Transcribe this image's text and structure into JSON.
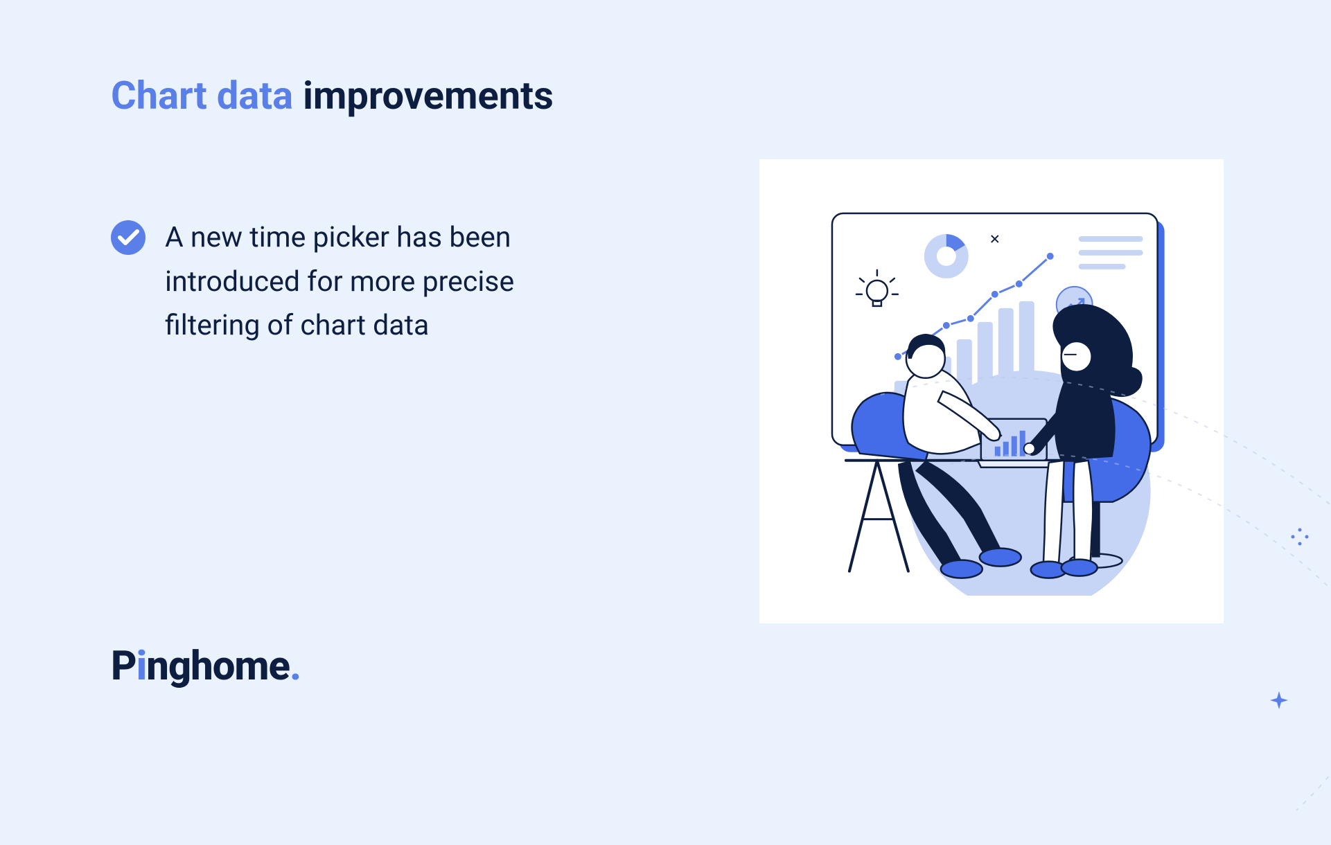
{
  "heading": {
    "highlight": "Chart data",
    "normal": "improvements"
  },
  "bullet": {
    "text": "A new time picker has been introduced for more precise filtering of chart data"
  },
  "logo": {
    "prefix": "P",
    "i_char": "i",
    "suffix": "nghome",
    "period": "."
  },
  "colors": {
    "background": "#EAF2FE",
    "accent": "#5B7FE8",
    "dark": "#0E1E40",
    "card": "#FFFFFF"
  }
}
